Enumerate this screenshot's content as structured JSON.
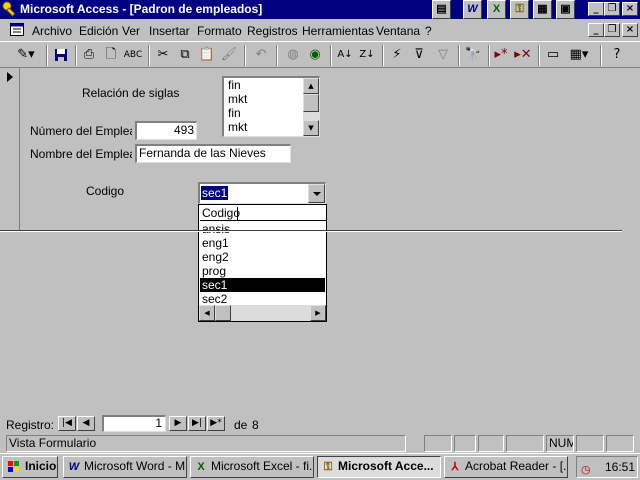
{
  "window": {
    "title": "Microsoft Access - [Padron de empleados]"
  },
  "menu": {
    "items": [
      {
        "label": "Archivo"
      },
      {
        "label": "Edición"
      },
      {
        "label": "Ver"
      },
      {
        "label": "Insertar"
      },
      {
        "label": "Formato"
      },
      {
        "label": "Registros"
      },
      {
        "label": "Herramientas"
      },
      {
        "label": "Ventana"
      },
      {
        "label": "?"
      }
    ]
  },
  "toolbar": {
    "icons": [
      "design-view-icon",
      "save-icon",
      "print-icon",
      "print-preview-icon",
      "spelling-icon",
      "cut-icon",
      "copy-icon",
      "paste-icon",
      "format-painter-icon",
      "undo-icon",
      "insert-hyperlink-icon",
      "web-toolbar-icon",
      "sort-ascending-icon",
      "sort-descending-icon",
      "filter-by-selection-icon",
      "filter-by-form-icon",
      "apply-filter-icon",
      "find-icon",
      "new-record-icon",
      "delete-record-icon",
      "database-window-icon",
      "new-object-icon",
      "help-icon"
    ]
  },
  "form": {
    "siglas_label": "Relación de siglas",
    "siglas_list": [
      "fin",
      "mkt",
      "fin",
      "mkt"
    ],
    "numero_label": "Número del Empleado",
    "numero_value": "493",
    "nombre_label": "Nombre del Empleado",
    "nombre_value": "Fernanda de las Nieves",
    "codigo_label": "Codigo",
    "codigo_value": "sec1",
    "dropdown": {
      "header": "Codigo",
      "options": [
        "ansis",
        "eng1",
        "eng2",
        "prog",
        "sec1",
        "sec2"
      ],
      "selected": "sec1"
    }
  },
  "navigation": {
    "label": "Registro:",
    "current": "1",
    "of_label": "de",
    "total": "8"
  },
  "status": {
    "text": "Vista Formulario",
    "num": "NUM"
  },
  "taskbar": {
    "start_label": "Inicio",
    "tasks": [
      {
        "label": "Microsoft Word - M...",
        "icon": "word-icon",
        "active": false
      },
      {
        "label": "Microsoft Excel - fi...",
        "icon": "excel-icon",
        "active": false
      },
      {
        "label": "Microsoft Acce...",
        "icon": "access-icon",
        "active": true
      },
      {
        "label": "Acrobat Reader - [...",
        "icon": "acrobat-icon",
        "active": false
      }
    ],
    "clock": "16:51"
  },
  "colors": {
    "titlebar": "#000080",
    "face": "#c0c0c0",
    "selection": "#000080"
  }
}
